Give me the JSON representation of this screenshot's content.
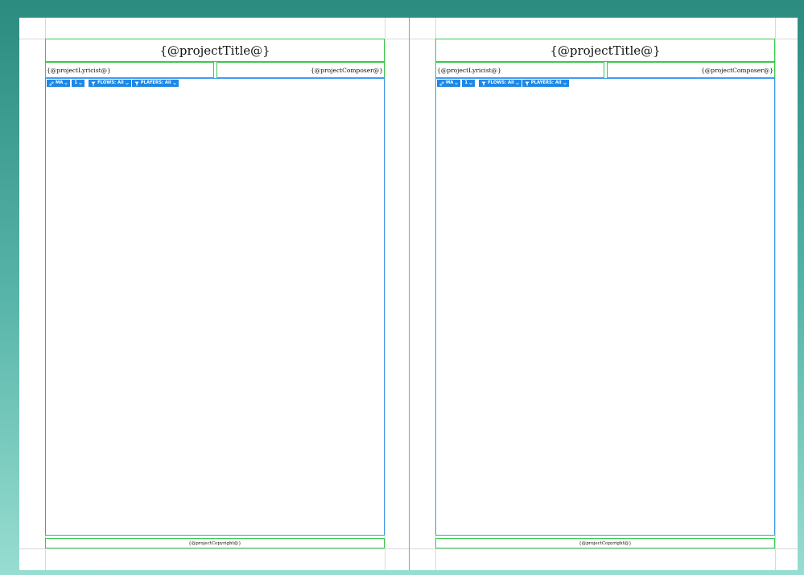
{
  "pages": [
    {
      "title": "{@projectTitle@}",
      "lyricist": "{@projectLyricist@}",
      "composer": "{@projectComposer@}",
      "copyright": "{@projectCopyright@}",
      "toolbar": {
        "link_label": "MA",
        "number_label": "1",
        "flows_label": "FLOWS: All",
        "players_label": "PLAYERS: All"
      }
    },
    {
      "title": "{@projectTitle@}",
      "lyricist": "{@projectLyricist@}",
      "composer": "{@projectComposer@}",
      "copyright": "{@projectCopyright@}",
      "toolbar": {
        "link_label": "MA",
        "number_label": "1",
        "flows_label": "FLOWS: All",
        "players_label": "PLAYERS: All"
      }
    }
  ],
  "colors": {
    "frame_border": "#37c94e",
    "music_frame_border": "#3b9ae8",
    "toolbar_bg": "#1e88e5",
    "background_top": "#2c8b7f",
    "background_bottom": "#98ddd1"
  },
  "icons": {
    "link": "link-icon",
    "filter": "filter-icon",
    "chevron": "chevron-down-icon"
  }
}
